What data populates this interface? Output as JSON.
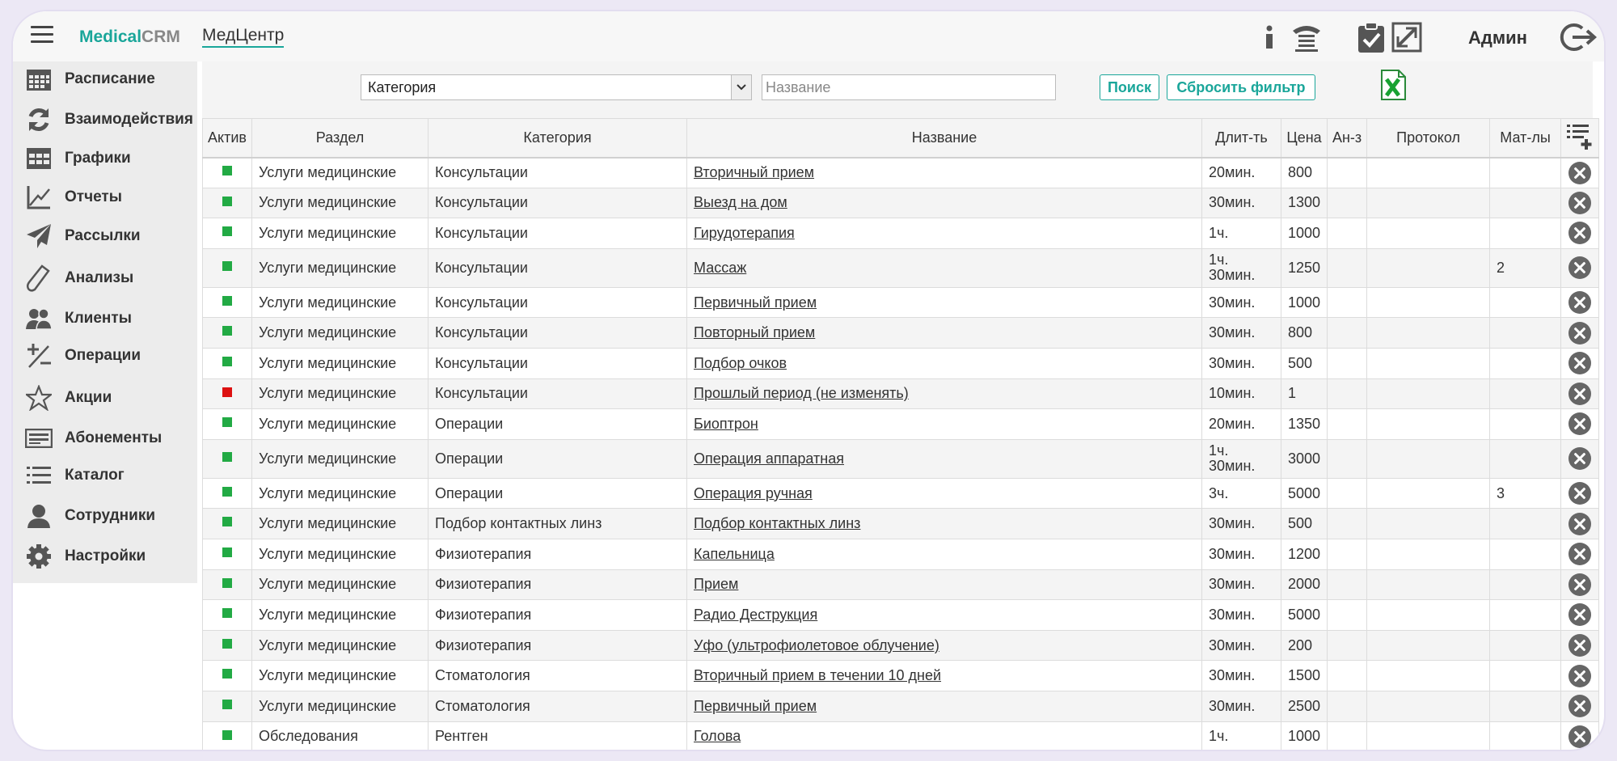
{
  "header": {
    "logo_a": "Medical",
    "logo_b": "CRM",
    "clinic": "МедЦентр",
    "user": "Админ"
  },
  "sidebar": {
    "items": [
      {
        "label": "Расписание",
        "icon": "calendar-icon"
      },
      {
        "label": "Взаимодействия",
        "icon": "refresh-icon"
      },
      {
        "label": "Графики",
        "icon": "grid-icon"
      },
      {
        "label": "Отчеты",
        "icon": "chart-icon"
      },
      {
        "label": "Рассылки",
        "icon": "paper-plane-icon"
      },
      {
        "label": "Анализы",
        "icon": "test-tube-icon"
      },
      {
        "label": "Клиенты",
        "icon": "users-icon"
      },
      {
        "label": "Операции",
        "icon": "plus-minus-icon"
      },
      {
        "label": "Акции",
        "icon": "star-icon"
      },
      {
        "label": "Абонементы",
        "icon": "card-icon"
      },
      {
        "label": "Каталог",
        "icon": "list-icon"
      },
      {
        "label": "Сотрудники",
        "icon": "user-icon"
      },
      {
        "label": "Настройки",
        "icon": "gear-icon"
      }
    ]
  },
  "filter": {
    "category_value": "Категория",
    "name_placeholder": "Название",
    "search_label": "Поиск",
    "reset_label": "Сбросить фильтр"
  },
  "table": {
    "headers": {
      "active": "Актив",
      "section": "Раздел",
      "category": "Категория",
      "name": "Название",
      "duration": "Длит-ть",
      "price": "Цена",
      "analyses": "Ан-з",
      "protocol": "Протокол",
      "materials": "Мат-лы"
    },
    "rows": [
      {
        "active": true,
        "section": "Услуги медицинские",
        "category": "Консультации",
        "name": "Вторичный прием",
        "d1": "20мин.",
        "d2": "",
        "price": "800",
        "mat": ""
      },
      {
        "active": true,
        "section": "Услуги медицинские",
        "category": "Консультации",
        "name": "Выезд на дом",
        "d1": "30мин.",
        "d2": "",
        "price": "1300",
        "mat": ""
      },
      {
        "active": true,
        "section": "Услуги медицинские",
        "category": "Консультации",
        "name": "Гирудотерапия",
        "d1": "1ч.",
        "d2": "",
        "price": "1000",
        "mat": ""
      },
      {
        "active": true,
        "section": "Услуги медицинские",
        "category": "Консультации",
        "name": "Массаж",
        "d1": "1ч.",
        "d2": "30мин.",
        "price": "1250",
        "mat": "2"
      },
      {
        "active": true,
        "section": "Услуги медицинские",
        "category": "Консультации",
        "name": "Первичный прием",
        "d1": "30мин.",
        "d2": "",
        "price": "1000",
        "mat": ""
      },
      {
        "active": true,
        "section": "Услуги медицинские",
        "category": "Консультации",
        "name": "Повторный прием",
        "d1": "30мин.",
        "d2": "",
        "price": "800",
        "mat": ""
      },
      {
        "active": true,
        "section": "Услуги медицинские",
        "category": "Консультации",
        "name": "Подбор очков",
        "d1": "30мин.",
        "d2": "",
        "price": "500",
        "mat": ""
      },
      {
        "active": false,
        "section": "Услуги медицинские",
        "category": "Консультации",
        "name": "Прошлый период (не изменять)",
        "d1": "10мин.",
        "d2": "",
        "price": "1",
        "mat": ""
      },
      {
        "active": true,
        "section": "Услуги медицинские",
        "category": "Операции",
        "name": "Биоптрон",
        "d1": "20мин.",
        "d2": "",
        "price": "1350",
        "mat": ""
      },
      {
        "active": true,
        "section": "Услуги медицинские",
        "category": "Операции",
        "name": "Операция аппаратная",
        "d1": "1ч.",
        "d2": "30мин.",
        "price": "3000",
        "mat": ""
      },
      {
        "active": true,
        "section": "Услуги медицинские",
        "category": "Операции",
        "name": "Операция ручная",
        "d1": "3ч.",
        "d2": "",
        "price": "5000",
        "mat": "3"
      },
      {
        "active": true,
        "section": "Услуги медицинские",
        "category": "Подбор контактных линз",
        "name": "Подбор контактных линз",
        "d1": "30мин.",
        "d2": "",
        "price": "500",
        "mat": ""
      },
      {
        "active": true,
        "section": "Услуги медицинские",
        "category": "Физиотерапия",
        "name": "Капельница",
        "d1": "30мин.",
        "d2": "",
        "price": "1200",
        "mat": ""
      },
      {
        "active": true,
        "section": "Услуги медицинские",
        "category": "Физиотерапия",
        "name": "Прием",
        "d1": "30мин.",
        "d2": "",
        "price": "2000",
        "mat": ""
      },
      {
        "active": true,
        "section": "Услуги медицинские",
        "category": "Физиотерапия",
        "name": "Радио Деструкция",
        "d1": "30мин.",
        "d2": "",
        "price": "5000",
        "mat": ""
      },
      {
        "active": true,
        "section": "Услуги медицинские",
        "category": "Физиотерапия",
        "name": "Уфо (ультрофиолетовое облучение)",
        "d1": "30мин.",
        "d2": "",
        "price": "200",
        "mat": ""
      },
      {
        "active": true,
        "section": "Услуги медицинские",
        "category": "Стоматология",
        "name": "Вторичный прием в течении 10 дней",
        "d1": "30мин.",
        "d2": "",
        "price": "1500",
        "mat": ""
      },
      {
        "active": true,
        "section": "Услуги медицинские",
        "category": "Стоматология",
        "name": "Первичный прием",
        "d1": "30мин.",
        "d2": "",
        "price": "2500",
        "mat": ""
      },
      {
        "active": true,
        "section": "Обследования",
        "category": "Рентген",
        "name": "Голова",
        "d1": "1ч.",
        "d2": "",
        "price": "1000",
        "mat": ""
      }
    ]
  },
  "colors": {
    "accent": "#1aa69a",
    "active": "#22aa44",
    "inactive": "#dd1111"
  }
}
